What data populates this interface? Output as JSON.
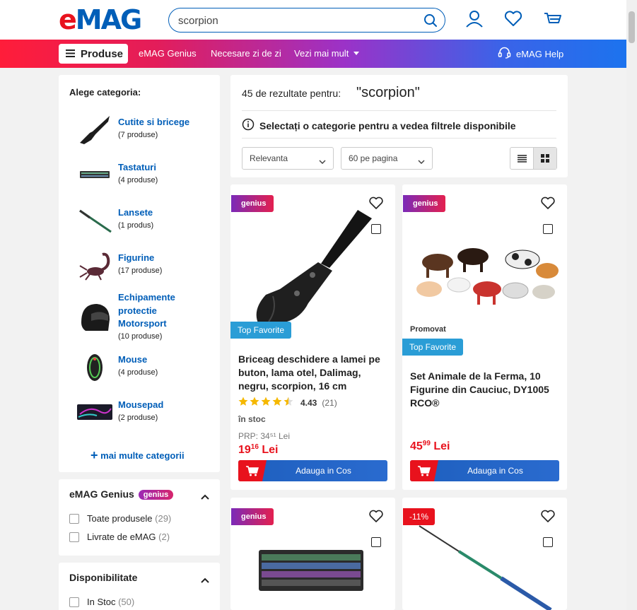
{
  "header": {
    "logo_e": "e",
    "logo_rest": "MAG",
    "search": {
      "value": "scorpion",
      "placeholder": ""
    }
  },
  "nav": {
    "products_label": "Produse",
    "links": [
      "eMAG Genius",
      "Necesare zi de zi",
      "Vezi mai mult"
    ],
    "help_label": "eMAG Help"
  },
  "sidebar": {
    "title": "Alege categoria:",
    "categories": [
      {
        "name": "Cutite si bricege",
        "count": "(7 produse)"
      },
      {
        "name": "Tastaturi",
        "count": "(4 produse)"
      },
      {
        "name": "Lansete",
        "count": "(1 produs)"
      },
      {
        "name": "Figurine",
        "count": "(17 produse)"
      },
      {
        "name": "Echipamente protectie Motorsport",
        "count": "(10 produse)"
      },
      {
        "name": "Mouse",
        "count": "(4 produse)"
      },
      {
        "name": "Mousepad",
        "count": "(2 produse)"
      }
    ],
    "more_label": "mai multe categorii"
  },
  "filters": {
    "genius": {
      "title": "eMAG Genius",
      "badge": "genius",
      "options": [
        {
          "label": "Toate produsele",
          "count": "(29)"
        },
        {
          "label": "Livrate de eMAG",
          "count": "(2)"
        }
      ]
    },
    "availability": {
      "title": "Disponibilitate",
      "options": [
        {
          "label": "In Stoc",
          "count": "(50)"
        }
      ]
    }
  },
  "results": {
    "count_text": "45 de rezultate pentru:",
    "query": "\"scorpion\"",
    "info": "Selectați o categorie pentru a vedea filtrele disponibile",
    "sort": "Relevanta",
    "per_page": "60 pe pagina"
  },
  "products": [
    {
      "tag": "genius",
      "badge": "Top Favorite",
      "title": "Briceag deschidere a lamei pe buton, lama otel, Dalimag, negru, scorpion, 16 cm",
      "rating": "4.43",
      "reviews": "(21)",
      "stock": "în stoc",
      "prp": "PRP: 34⁵¹ Lei",
      "price_int": "19",
      "price_dec": "16",
      "currency": "Lei",
      "button": "Adauga in Cos"
    },
    {
      "tag": "genius",
      "promo": "Promovat",
      "badge": "Top Favorite",
      "title": "Set Animale de la Ferma, 10 Figurine din Cauciuc, DY1005 RCO®",
      "price_int": "45",
      "price_dec": "99",
      "currency": "Lei",
      "button": "Adauga in Cos"
    },
    {
      "tag": "genius"
    },
    {
      "discount": "-11%"
    }
  ],
  "colors": {
    "brand_red": "#e8121d",
    "brand_blue": "#005eb8",
    "link_blue": "#005eb8"
  }
}
